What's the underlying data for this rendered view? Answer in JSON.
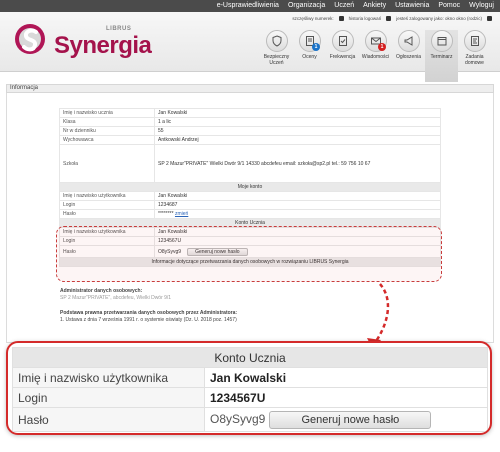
{
  "topnav": [
    "e-Usprawiedliwienia",
    "Organizacja",
    "Uczeń",
    "Ankiety",
    "Ustawienia",
    "Pomoc",
    "Wyloguj"
  ],
  "logo": {
    "brand": "Synergia",
    "sub": "LIBRUS"
  },
  "statusline": {
    "lucky_number": "szczęśliwy numerek:",
    "history": "historia logowań",
    "logged_in": "jesteś zalogowany jako: okno okno (rodzic)"
  },
  "iconbar": [
    {
      "label": "Bezpieczny Uczeń",
      "icon": "shield-icon",
      "badge": ""
    },
    {
      "label": "Oceny",
      "icon": "grades-icon",
      "badge": "1"
    },
    {
      "label": "Frekwencja",
      "icon": "attendance-icon",
      "badge": ""
    },
    {
      "label": "Wiadomości",
      "icon": "envelope-icon",
      "badge": "1"
    },
    {
      "label": "Ogłoszenia",
      "icon": "megaphone-icon",
      "badge": ""
    },
    {
      "label": "Terminarz",
      "icon": "calendar-icon",
      "badge": ""
    },
    {
      "label": "Zadania domowe",
      "icon": "homework-icon",
      "badge": ""
    }
  ],
  "section_title": "Informacja",
  "info_rows": [
    {
      "k": "Imię i nazwisko ucznia",
      "v": "Jan Kowalski"
    },
    {
      "k": "Klasa",
      "v": "1 a lic"
    },
    {
      "k": "Nr w dzienniku",
      "v": "55"
    },
    {
      "k": "Wychowawca",
      "v": "Antkowski Andrzej"
    },
    {
      "k": "Szkoła",
      "v": "SP 2 Mazur\"PRIVATE\" Wielki Dwór 9/1 14330 abcdefeu email: szkoła@sp2.pl tel.: 59 756 10 67"
    }
  ],
  "moje_konto": {
    "title": "Moje konto",
    "rows": [
      {
        "k": "Imię i nazwisko użytkownika",
        "v": "Jan Kowalski"
      },
      {
        "k": "Login",
        "v": "1234687"
      },
      {
        "k": "Hasło",
        "v": "********",
        "link": "zmień"
      }
    ]
  },
  "konto_ucznia": {
    "title": "Konto Ucznia",
    "rows": [
      {
        "k": "Imię i nazwisko użytkownika",
        "v": "Jan Kowalski"
      },
      {
        "k": "Login",
        "v": "1234567U"
      },
      {
        "k": "Hasło",
        "v": "O8ySyvg9"
      }
    ],
    "button": "Generuj nowe hasło",
    "footer": "Informacje dotyczące przetwarzania danych osobowych w rozwiązaniu LIBRUS Synergia"
  },
  "admin": {
    "heading": "Administrator danych osobowych:",
    "address": "SP 2 Mazur\"PRIVATE\", abcdefeu, Wielki Dwór 9/1",
    "legal_heading": "Podstawa prawna przetwarzania danych osobowych przez Administratora:",
    "legal_line": "1. Ustawa z dnia 7 września 1991 r. o systemie oświaty (Dz. U. 2018 poz. 1457)"
  },
  "colors": {
    "brand": "#a4124b",
    "accent_red": "#d42a2a",
    "link": "#2a64b8"
  }
}
